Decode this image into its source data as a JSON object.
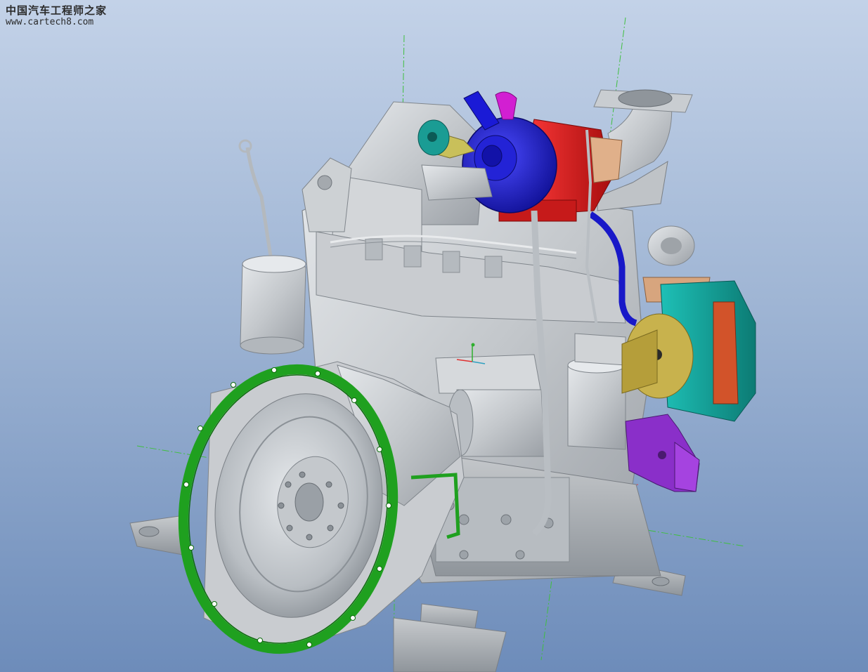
{
  "watermark": {
    "site_name": "中国汽车工程师之家",
    "url": "www.cartech8.com"
  },
  "viewport": {
    "background_top": "#c3d2e8",
    "background_bottom": "#6d8cba",
    "model": "diesel engine assembly"
  },
  "colors": {
    "engine_body": "#c4c8cc",
    "flywheel_housing_flange": "#1fa01f",
    "turbo_compressor": "#1818c8",
    "turbo_center": "#dd1b1b",
    "exhaust_elbow": "#c9cdd1",
    "alternator": "#17a29a",
    "alternator_pulley": "#c8b24d",
    "water_pump": "#8a2fc9",
    "bracket": "#d7a57e",
    "axis_x": "#e03030",
    "axis_y": "#2faf2f"
  }
}
